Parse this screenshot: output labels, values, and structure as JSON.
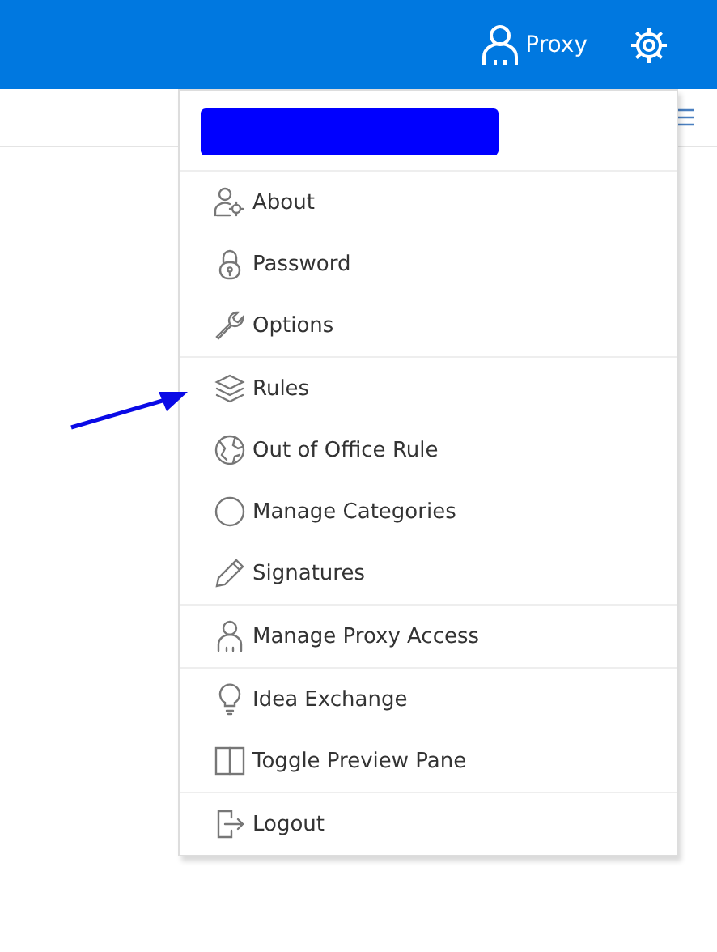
{
  "header": {
    "proxy_label": "Proxy"
  },
  "menu": {
    "redacted": true,
    "groups": [
      {
        "items": [
          {
            "label": "About",
            "kind": "user-gear"
          },
          {
            "label": "Password",
            "kind": "lock"
          },
          {
            "label": "Options",
            "kind": "wrench"
          }
        ]
      },
      {
        "items": [
          {
            "label": "Rules",
            "kind": "layers"
          },
          {
            "label": "Out of Office Rule",
            "kind": "globe"
          },
          {
            "label": "Manage Categories",
            "kind": "circle"
          },
          {
            "label": "Signatures",
            "kind": "pencil"
          }
        ]
      },
      {
        "items": [
          {
            "label": "Manage Proxy Access",
            "kind": "person"
          }
        ]
      },
      {
        "items": [
          {
            "label": "Idea Exchange",
            "kind": "bulb"
          },
          {
            "label": "Toggle Preview Pane",
            "kind": "columns"
          }
        ]
      },
      {
        "items": [
          {
            "label": "Logout",
            "kind": "logout"
          }
        ]
      }
    ]
  },
  "annotation": {
    "kind": "arrow"
  }
}
